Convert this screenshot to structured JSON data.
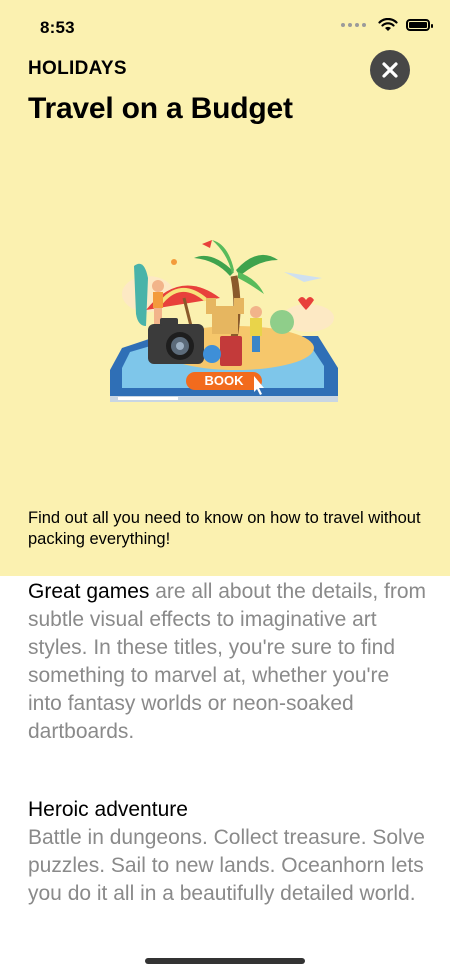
{
  "status_bar": {
    "time": "8:53"
  },
  "header": {
    "category": "HOLIDAYS",
    "title": "Travel on a Budget",
    "tagline": "Find out all you need to know on how to travel without packing everything!"
  },
  "illustration": {
    "button_label": "BOOK"
  },
  "article": {
    "paragraph1": {
      "lead": "Great games",
      "rest": " are all about the details, from subtle visual effects to imaginative art styles. In these titles, you're sure to find something to marvel at, whether you're into fantasy worlds or neon-soaked dartboards."
    },
    "paragraph2": {
      "heading": "Heroic adventure",
      "text": "Battle in dungeons. Collect treasure. Solve puzzles. Sail to new lands. Oceanhorn lets you do it all in a beautifully detailed world."
    }
  },
  "colors": {
    "card_background": "#fbf1b0",
    "close_button": "#474747",
    "secondary_text": "#8a8a8a"
  },
  "icons": [
    "wifi-icon",
    "battery-icon",
    "close-icon",
    "cellular-signal-icon"
  ]
}
